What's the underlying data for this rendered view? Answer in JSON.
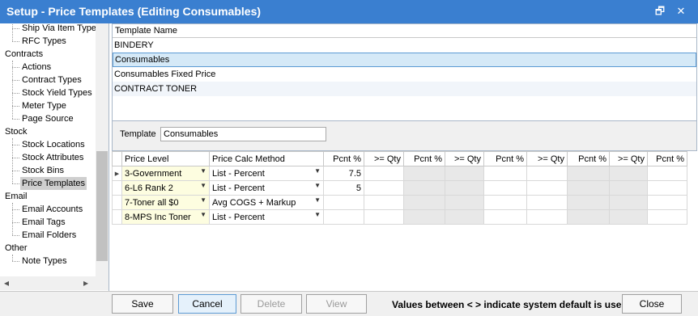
{
  "window": {
    "title": "Setup - Price Templates (Editing Consumables)",
    "restore_glyph": "🗗",
    "close_glyph": "✕"
  },
  "sidebar": {
    "items": [
      {
        "label": "Ship Via Item Types",
        "type": "child"
      },
      {
        "label": "RFC Types",
        "type": "child"
      },
      {
        "label": "Contracts",
        "type": "cat"
      },
      {
        "label": "Actions",
        "type": "child"
      },
      {
        "label": "Contract Types",
        "type": "child"
      },
      {
        "label": "Stock Yield Types",
        "type": "child"
      },
      {
        "label": "Meter Type",
        "type": "child"
      },
      {
        "label": "Page Source",
        "type": "child"
      },
      {
        "label": "Stock",
        "type": "cat"
      },
      {
        "label": "Stock Locations",
        "type": "child"
      },
      {
        "label": "Stock Attributes",
        "type": "child"
      },
      {
        "label": "Stock Bins",
        "type": "child"
      },
      {
        "label": "Price Templates",
        "type": "child",
        "selected": true
      },
      {
        "label": "Email",
        "type": "cat"
      },
      {
        "label": "Email Accounts",
        "type": "child"
      },
      {
        "label": "Email Tags",
        "type": "child"
      },
      {
        "label": "Email Folders",
        "type": "child"
      },
      {
        "label": "Other",
        "type": "cat"
      },
      {
        "label": "Note Types",
        "type": "child"
      }
    ],
    "scroll_left_glyph": "◂",
    "scroll_right_glyph": "▸"
  },
  "template_list": {
    "header": "Template Name",
    "rows": [
      "BINDERY",
      "Consumables",
      "Consumables Fixed Price",
      "CONTRACT TONER"
    ],
    "selected_index": 1
  },
  "template_form": {
    "label": "Template",
    "value": "Consumables"
  },
  "grid": {
    "headers": [
      "Price Level",
      "Price Calc Method",
      "Pcnt %",
      ">= Qty",
      "Pcnt %",
      ">= Qty",
      "Pcnt %",
      ">= Qty",
      "Pcnt %",
      ">= Qty",
      "Pcnt %"
    ],
    "row_indicator": "▶",
    "dropdown_glyph": "▼",
    "rows": [
      {
        "level": "3-Government",
        "method": "List - Percent",
        "pcnt": "7.5"
      },
      {
        "level": "6-L6 Rank 2",
        "method": "List - Percent",
        "pcnt": "5"
      },
      {
        "level": "7-Toner all $0",
        "method": "Avg COGS + Markup",
        "pcnt": ""
      },
      {
        "level": "8-MPS Inc Toner",
        "method": "List - Percent",
        "pcnt": ""
      }
    ]
  },
  "buttons": {
    "save": "Save",
    "cancel": "Cancel",
    "delete": "Delete",
    "view": "View",
    "close": "Close"
  },
  "note": "Values between < > indicate system default is use"
}
